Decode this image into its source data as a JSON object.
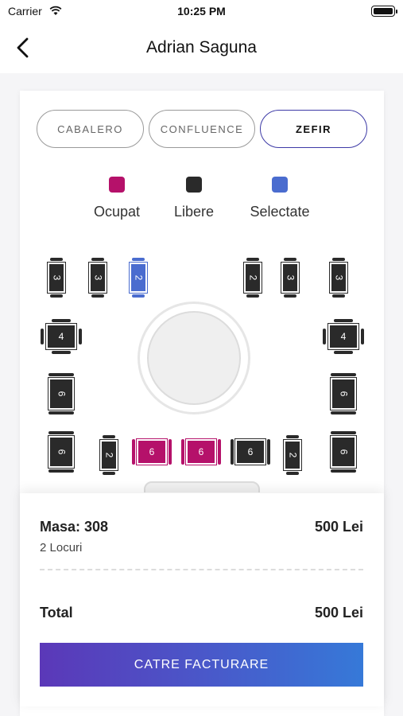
{
  "status_bar": {
    "carrier": "Carrier",
    "time": "10:25 PM"
  },
  "nav": {
    "title": "Adrian Saguna"
  },
  "tabs": [
    {
      "label": "CABALERO",
      "active": false
    },
    {
      "label": "CONFLUENCE",
      "active": false
    },
    {
      "label": "ZEFIR",
      "active": true
    }
  ],
  "legend": [
    {
      "label": "Ocupat",
      "color": "#b5116a"
    },
    {
      "label": "Libere",
      "color": "#2a2a2a"
    },
    {
      "label": "Selectate",
      "color": "#4a6ccf"
    }
  ],
  "tables": [
    {
      "seats": "3",
      "state": "free"
    },
    {
      "seats": "3",
      "state": "free"
    },
    {
      "seats": "2",
      "state": "selected"
    },
    {
      "seats": "2",
      "state": "free"
    },
    {
      "seats": "3",
      "state": "free"
    },
    {
      "seats": "3",
      "state": "free"
    },
    {
      "seats": "4",
      "state": "free"
    },
    {
      "seats": "4",
      "state": "free"
    },
    {
      "seats": "6",
      "state": "free"
    },
    {
      "seats": "6",
      "state": "free"
    },
    {
      "seats": "6",
      "state": "free"
    },
    {
      "seats": "2",
      "state": "free"
    },
    {
      "seats": "6",
      "state": "occupied"
    },
    {
      "seats": "6",
      "state": "occupied"
    },
    {
      "seats": "6",
      "state": "free"
    },
    {
      "seats": "2",
      "state": "free"
    },
    {
      "seats": "6",
      "state": "free"
    }
  ],
  "summary": {
    "table_label": "Masa: 308",
    "price": "500 Lei",
    "seats_label": "2 Locuri",
    "total_label": "Total",
    "total_value": "500 Lei",
    "cta_label": "CATRE FACTURARE"
  }
}
